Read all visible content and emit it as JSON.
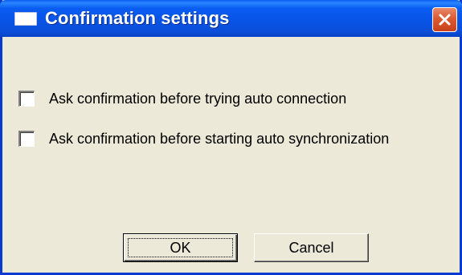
{
  "window": {
    "title": "Confirmation settings",
    "title_icon": "window-icon",
    "close_icon": "close-icon"
  },
  "options": [
    {
      "label": "Ask confirmation before trying auto connection",
      "checked": false
    },
    {
      "label": "Ask confirmation before starting auto synchronization",
      "checked": false
    }
  ],
  "buttons": {
    "ok_label": "OK",
    "cancel_label": "Cancel"
  },
  "colors": {
    "titlebar": "#0a5df2",
    "close_button": "#d9532c",
    "dialog_background": "#ece9d8"
  }
}
